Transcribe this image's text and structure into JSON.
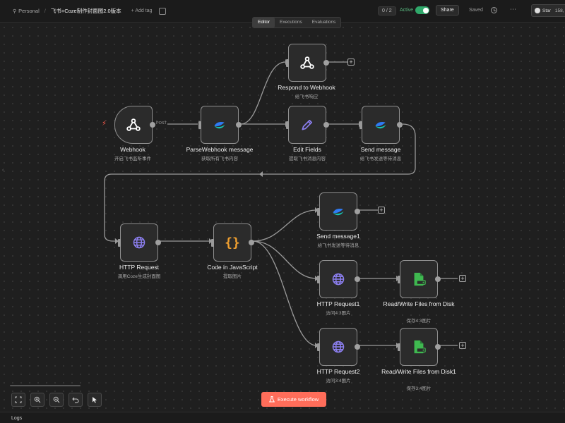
{
  "header": {
    "project": "Personal",
    "workflow_title": "飞书+Coze制作封面图2.0版本",
    "add_tag": "+ Add tag",
    "counter": "0 / 2",
    "active_label": "Active",
    "share_label": "Share",
    "saved_label": "Saved",
    "github_star_label": "Star",
    "github_star_count": "158,"
  },
  "tabs": [
    {
      "label": "Editor",
      "active": true
    },
    {
      "label": "Executions",
      "active": false
    },
    {
      "label": "Evaluations",
      "active": false
    }
  ],
  "nodes": {
    "webhook": {
      "title": "Webhook",
      "subtitle": "开启飞书监听事件",
      "icon": "webhook-icon"
    },
    "parse": {
      "title": "ParseWebhook message",
      "subtitle": "获取所有飞书内容",
      "icon": "feishu-icon"
    },
    "respond": {
      "title": "Respond to Webhook",
      "subtitle": "给飞书响应",
      "icon": "webhook-icon"
    },
    "edit": {
      "title": "Edit Fields",
      "subtitle": "提取飞书消息内容",
      "icon": "pencil-icon"
    },
    "send": {
      "title": "Send message",
      "subtitle": "给飞书发送等待消息",
      "icon": "feishu-icon"
    },
    "http": {
      "title": "HTTP Request",
      "subtitle": "调用Coze生成封面图",
      "icon": "globe-icon"
    },
    "code": {
      "title": "Code in JavaScript",
      "subtitle": "提取图片",
      "icon": "code-braces-icon"
    },
    "send1": {
      "title": "Send message1",
      "subtitle": "给飞书发送等待消息",
      "icon": "feishu-icon"
    },
    "http1": {
      "title": "HTTP Request1",
      "subtitle": "访问4:3图片",
      "icon": "globe-icon"
    },
    "rw1": {
      "title": "Read/Write Files from Disk",
      "subtitle": "保存4:3图片",
      "icon": "file-disk-icon"
    },
    "http2": {
      "title": "HTTP Request2",
      "subtitle": "访问3:4图片",
      "icon": "globe-icon"
    },
    "rw2": {
      "title": "Read/Write Files from Disk1",
      "subtitle": "保存3:4图片",
      "icon": "file-disk-icon"
    }
  },
  "edge_labels": {
    "post": "POST"
  },
  "footer": {
    "execute_label": "Execute workflow",
    "logs_label": "Logs"
  },
  "colors": {
    "accent": "#ff6d5a",
    "active_green": "#2fa86a",
    "code_orange": "#f0a030",
    "globe_purple": "#8c7ff0",
    "pencil_purple": "#8c7ff0",
    "file_green": "#3fb950",
    "feishu_blue": "#2f7bf5",
    "feishu_teal": "#17c3b2"
  }
}
